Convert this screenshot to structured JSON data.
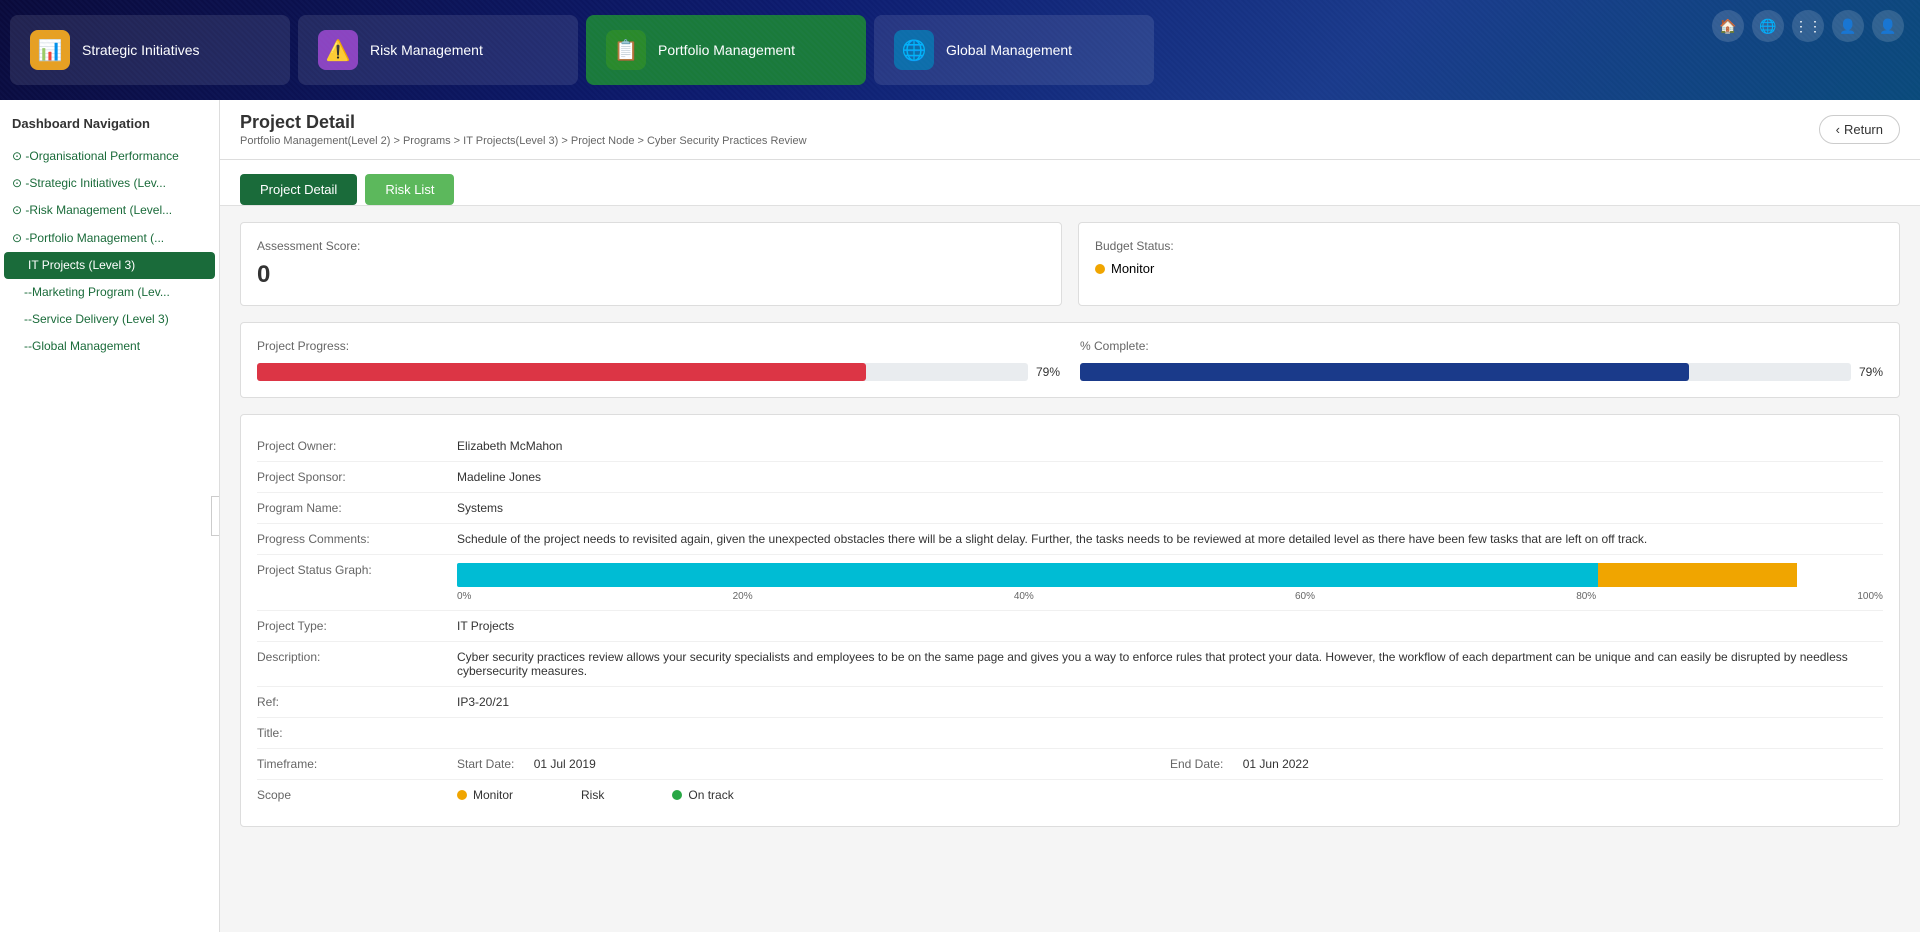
{
  "header": {
    "nav_tabs": [
      {
        "id": "strategic",
        "label": "Strategic Initiatives",
        "icon": "📊",
        "active": false,
        "icon_bg": "#e8a020"
      },
      {
        "id": "risk",
        "label": "Risk Management",
        "icon": "⚠️",
        "active": false,
        "icon_bg": "#8b44c0"
      },
      {
        "id": "portfolio",
        "label": "Portfolio Management",
        "icon": "📋",
        "active": true,
        "icon_bg": "#2a8a2a"
      },
      {
        "id": "global",
        "label": "Global Management",
        "icon": "🌐",
        "active": false,
        "icon_bg": "#0d6eaa"
      }
    ],
    "icons": [
      "🏠",
      "🌐",
      "⋮⋮⋮",
      "👤",
      "👤"
    ]
  },
  "sidebar": {
    "title": "Dashboard Navigation",
    "items": [
      {
        "id": "org-perf",
        "label": "-Organisational Performance",
        "indent": 0,
        "active": false
      },
      {
        "id": "strategic",
        "label": "-Strategic Initiatives (Lev...",
        "indent": 0,
        "active": false
      },
      {
        "id": "risk",
        "label": "-Risk Management (Level...",
        "indent": 0,
        "active": false
      },
      {
        "id": "portfolio",
        "label": "-Portfolio Management (...",
        "indent": 0,
        "active": false
      },
      {
        "id": "it-projects",
        "label": "IT Projects (Level 3)",
        "indent": 1,
        "active": true
      },
      {
        "id": "marketing",
        "label": "--Marketing Program (Lev...",
        "indent": 1,
        "active": false
      },
      {
        "id": "service",
        "label": "--Service Delivery (Level 3)",
        "indent": 1,
        "active": false
      },
      {
        "id": "global",
        "label": "--Global Management",
        "indent": 1,
        "active": false
      }
    ]
  },
  "page": {
    "title": "Project Detail",
    "breadcrumb": "Portfolio Management(Level 2) > Programs > IT Projects(Level 3) > Project Node > Cyber Security Practices Review",
    "return_label": "Return",
    "tabs": [
      {
        "id": "project-detail",
        "label": "Project Detail",
        "active": true
      },
      {
        "id": "risk-list",
        "label": "Risk List",
        "active": false
      }
    ]
  },
  "assessment": {
    "label": "Assessment Score:",
    "value": "0"
  },
  "budget": {
    "label": "Budget Status:",
    "status": "Monitor",
    "status_color": "yellow"
  },
  "project_progress": {
    "label": "Project Progress:",
    "percent": 79,
    "percent_label": "79%"
  },
  "complete": {
    "label": "% Complete:",
    "percent": 79,
    "percent_label": "79%"
  },
  "details": [
    {
      "key": "Project Owner:",
      "value": "Elizabeth McMahon"
    },
    {
      "key": "Project Sponsor:",
      "value": "Madeline Jones"
    },
    {
      "key": "Program Name:",
      "value": "Systems"
    },
    {
      "key": "Progress Comments:",
      "value": "Schedule of the project needs to revisited again, given the unexpected obstacles there will be a slight delay. Further, the tasks needs to be reviewed at more detailed level as there have been few tasks that are left on off track."
    },
    {
      "key": "Project Status Graph:",
      "value": "",
      "is_graph": true
    }
  ],
  "status_graph": {
    "cyan_pct": 80,
    "yellow_pct": 14,
    "labels": [
      "0%",
      "20%",
      "40%",
      "60%",
      "80%",
      "100%"
    ]
  },
  "more_details": [
    {
      "key": "Project Type:",
      "value": "IT Projects"
    },
    {
      "key": "Description:",
      "value": "Cyber security practices review allows your security specialists and employees to be on the same page and gives you a way to enforce rules that protect your data. However, the workflow of each department can be unique and can easily be disrupted by needless cybersecurity measures."
    },
    {
      "key": "Ref:",
      "value": "IP3-20/21"
    },
    {
      "key": "Title:",
      "value": ""
    }
  ],
  "timeframe": {
    "label": "Timeframe:",
    "start_label": "Start Date:",
    "start_val": "01 Jul 2019",
    "end_label": "End Date:",
    "end_val": "01 Jun 2022"
  },
  "scope": {
    "label": "Scope",
    "items": [
      {
        "name": "Monitor",
        "color": "yellow"
      },
      {
        "name": "Risk",
        "color": "none"
      },
      {
        "name": "On track",
        "color": "green"
      }
    ]
  }
}
